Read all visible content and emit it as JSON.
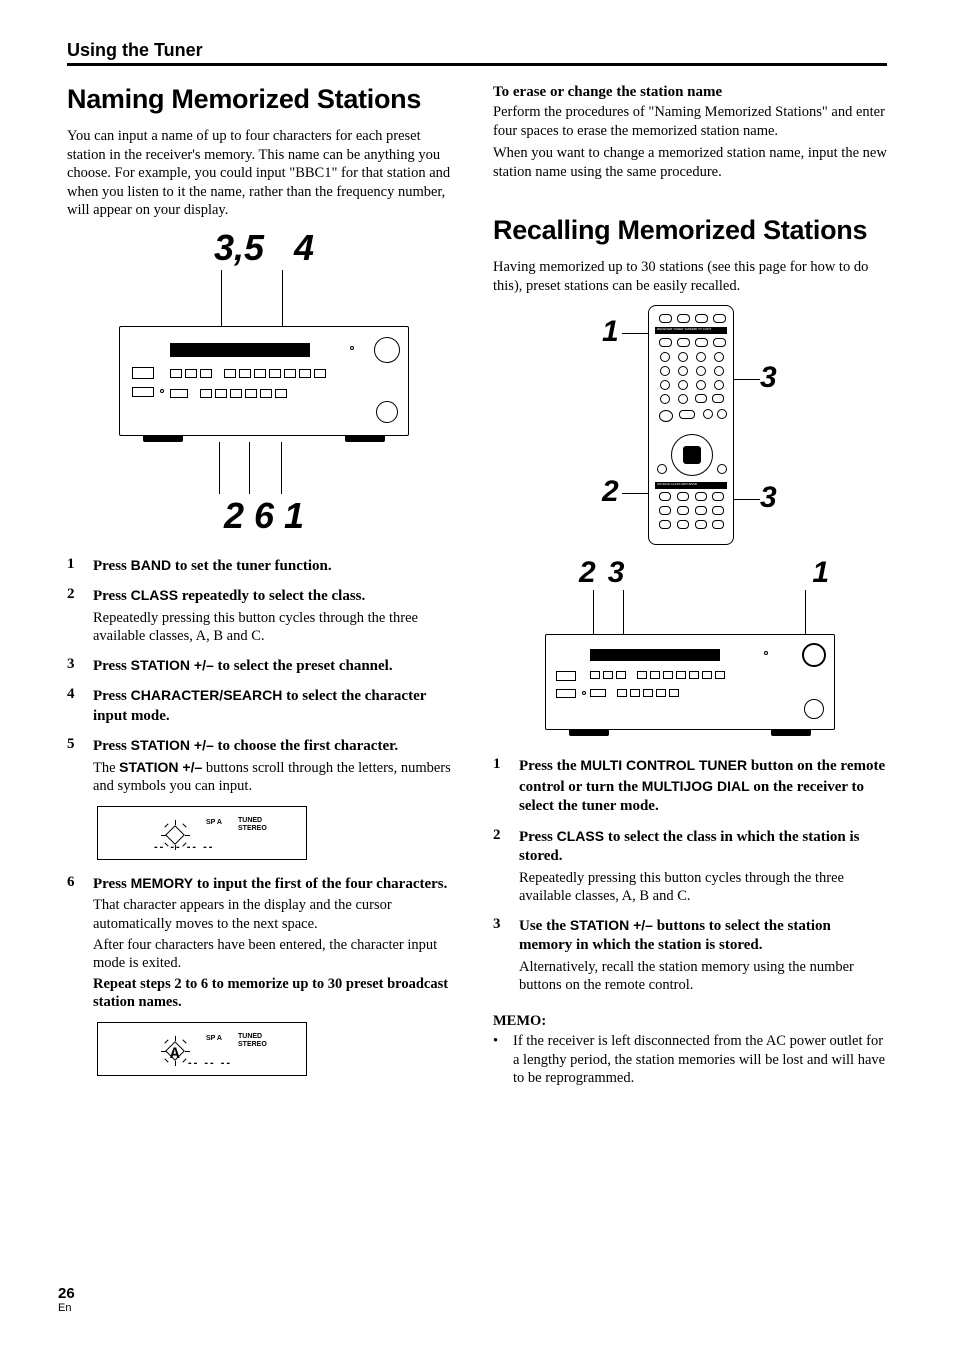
{
  "sectionTitle": "Using the Tuner",
  "left": {
    "h1": "Naming Memorized Stations",
    "intro": "You can input a name of up to four characters for each preset station in the receiver's memory. This name can be anything you choose. For example, you could input \"BBC1\" for that station and when you listen to it the name, rather than the frequency number, will appear on your display.",
    "figTop1": "3,5",
    "figTop2": "4",
    "figBot1": "2",
    "figBot2": "6",
    "figBot3": "1",
    "steps": [
      {
        "n": "1",
        "pre": "Press ",
        "btn": "BAND",
        "post": " to set the tuner function."
      },
      {
        "n": "2",
        "pre": "Press ",
        "btn": "CLASS",
        "post": " repeatedly to select the class.",
        "follow": "Repeatedly pressing this button cycles through the three available classes, A, B and C."
      },
      {
        "n": "3",
        "pre": "Press ",
        "btn": "STATION +/–",
        "post": " to select the preset channel."
      },
      {
        "n": "4",
        "pre": "Press ",
        "btn": "CHARACTER/SEARCH",
        "post": " to select the character input mode."
      },
      {
        "n": "5",
        "pre": "Press ",
        "btn": "STATION +/–",
        "post": " to choose the first character.",
        "follow_pre": "The ",
        "follow_btn": "STATION +/–",
        "follow_post": " buttons scroll through the letters, numbers and symbols you can input."
      },
      {
        "n": "6",
        "pre": "Press ",
        "btn": "MEMORY",
        "post": " to input the first of the four characters.",
        "follow": "That character appears in the display and the cursor automatically moves to the next space.",
        "follow2": "After four characters have been entered, the character input mode is exited.",
        "repeat": "Repeat steps 2 to 6 to memorize up to 30 preset broadcast station names."
      }
    ],
    "lcdSPA": "SP  A",
    "lcdTuned": "TUNED",
    "lcdStereo": "STEREO",
    "lcdDashes1": "-- --   --   --",
    "lcdGlyph": "A",
    "lcdDashes2": "--   --   --"
  },
  "right": {
    "eraseHead": "To erase or change the station name",
    "erase1": "Perform the procedures of \"Naming Memorized Stations\" and  enter four spaces to erase the memorized station name.",
    "erase2": "When you want to change a memorized station name, input the new station name using the same procedure.",
    "h1": "Recalling Memorized Stations",
    "intro": "Having memorized up to 30 stations (see this page for how to do this), preset stations can be easily recalled.",
    "remote": {
      "l1": "1",
      "l2": "2",
      "r3a": "3",
      "r3b": "3"
    },
    "receiver": {
      "left1": "2",
      "left2": "3",
      "right": "1"
    },
    "steps": [
      {
        "n": "1",
        "pre": "Press the ",
        "btn": "MULTI CONTROL TUNER",
        "mid": " button on the remote control or turn the ",
        "btn2": "MULTIJOG DIAL",
        "post": " on the receiver to select the tuner mode."
      },
      {
        "n": "2",
        "pre": "Press ",
        "btn": "CLASS",
        "post": " to select the class in which the station is stored.",
        "follow": "Repeatedly pressing this button cycles through the three available classes, A, B and C."
      },
      {
        "n": "3",
        "pre": "Use the ",
        "btn": "STATION +/–",
        "post": " buttons to select the station memory in which the station is stored.",
        "follow": "Alternatively, recall the station memory using the number buttons on the remote control."
      }
    ],
    "memoLabel": "MEMO:",
    "memo": "If the receiver is left disconnected from the AC power outlet for a lengthy period, the station memories will be lost and will have to be reprogrammed."
  },
  "page": {
    "num": "26",
    "lang": "En"
  }
}
